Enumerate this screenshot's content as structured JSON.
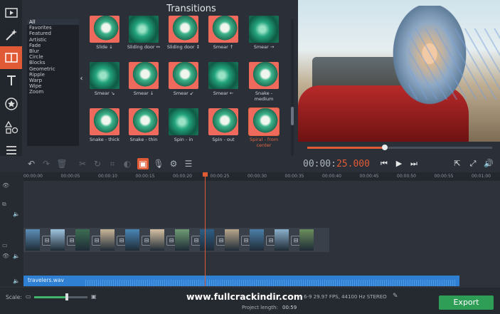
{
  "panel": {
    "title": "Transitions",
    "collapse_glyph": "‹",
    "categories": [
      "All",
      "Favorites",
      "Featured",
      "Artistic",
      "Fade",
      "Blur",
      "Circle",
      "Blocks",
      "Geometric",
      "Ripple",
      "Warp",
      "Wipe",
      "Zoom"
    ],
    "selected_category": "All",
    "transitions": [
      [
        "Slide ↓",
        "Sliding door ↔",
        "Sliding door ↕",
        "Smear ↑",
        "Smear →"
      ],
      [
        "Smear ↘",
        "Smear ↓",
        "Smear ↙",
        "Smear ←",
        "Snake - medium"
      ],
      [
        "Snake - thick",
        "Snake - thin",
        "Spin - in",
        "Spin - out",
        "Spiral - from center"
      ]
    ],
    "highlighted": "Spiral - from center"
  },
  "tools": [
    "clips-icon",
    "magic-wand-icon",
    "transitions-icon",
    "titles-icon",
    "stickers-icon",
    "shapes-icon",
    "menu-icon"
  ],
  "player": {
    "time_prefix": "00:00:",
    "time_active": "25.000",
    "progress": 0.42
  },
  "ruler": [
    "00:00:00",
    "00:00:05",
    "00:00:10",
    "00:00:15",
    "00:00:20",
    "00:00:25",
    "00:00:30",
    "00:00:35",
    "00:00:40",
    "00:00:45",
    "00:00:50",
    "00:00:55",
    "00:01:00"
  ],
  "timeline": {
    "audio_clip": "travelers.wav",
    "playhead_time": "00:00:25"
  },
  "bottom": {
    "scale_label": "Scale:",
    "settings_text": "6-9 29.97 FPS, 44100 Hz STEREO",
    "project_length_label": "Project length:",
    "project_length_value": "00:59",
    "watermark": "www.fullcrackindir.com",
    "export_label": "Export"
  },
  "colors": {
    "accent": "#e15a36",
    "export": "#2e9e56",
    "audio": "#2f7fd3"
  }
}
